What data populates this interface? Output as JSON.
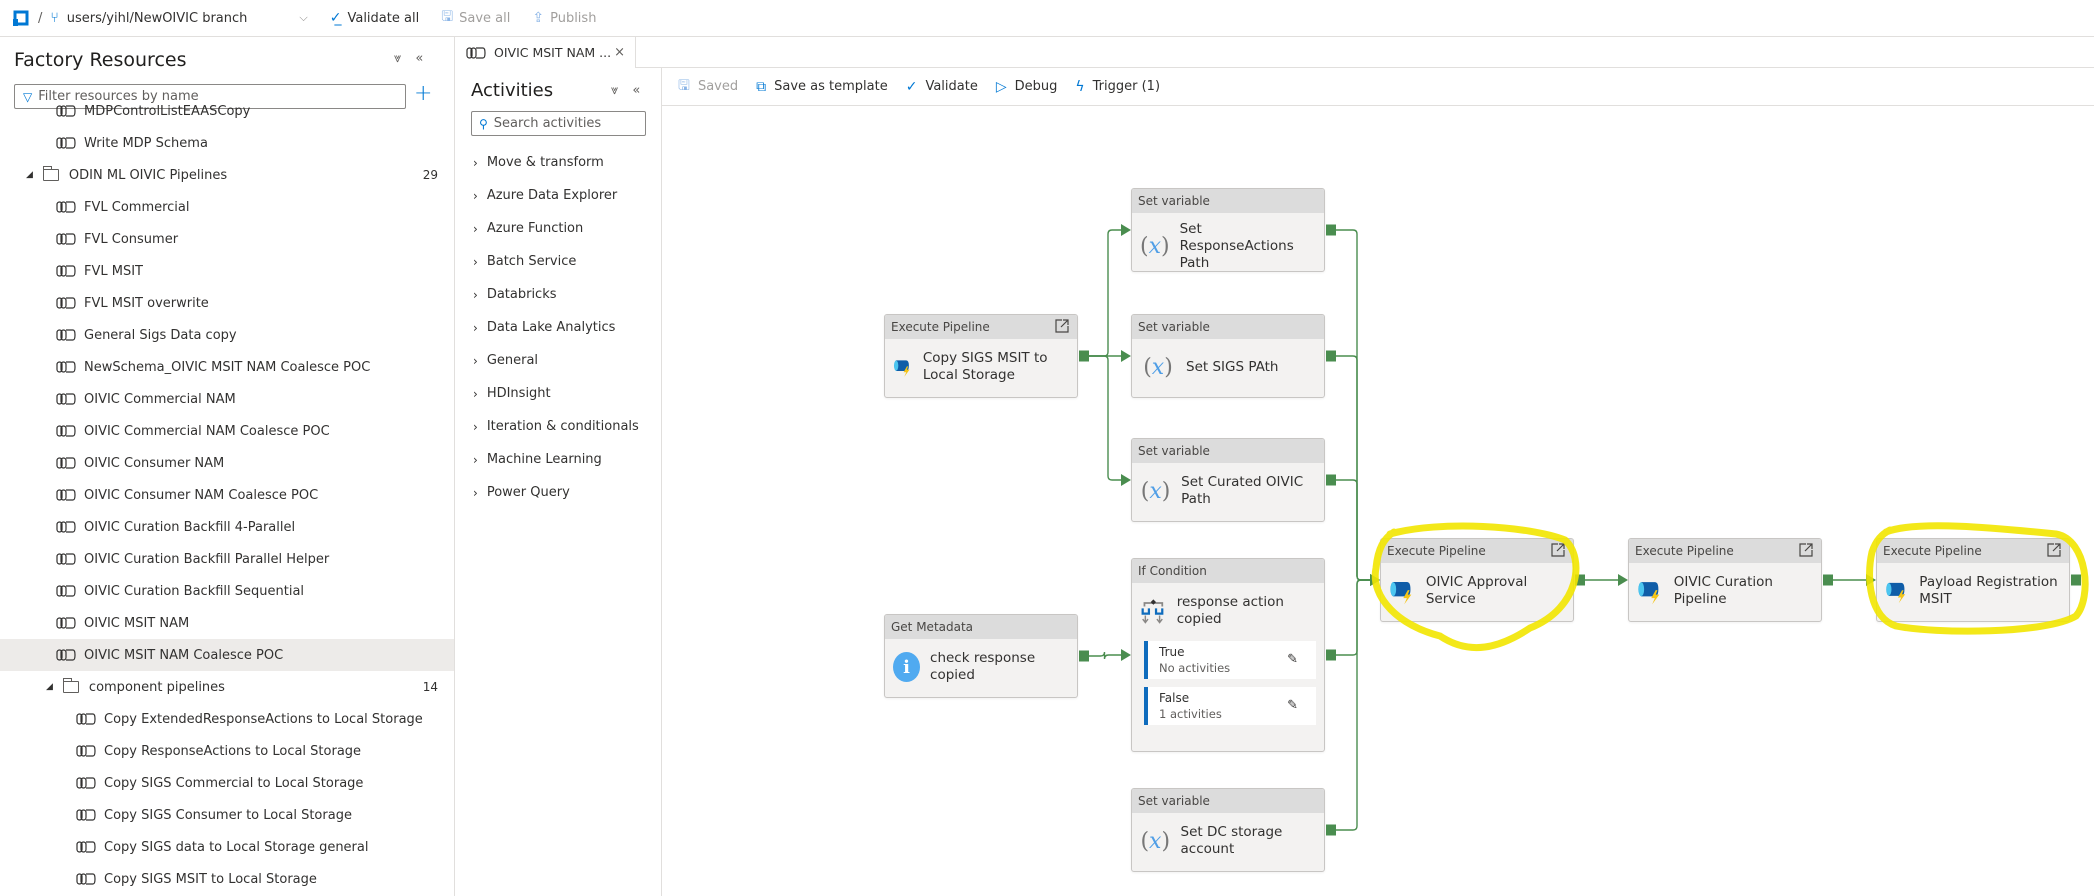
{
  "topbar": {
    "separator": "/",
    "branch": "users/yihl/NewOIVIC branch",
    "validate_all": "Validate all",
    "save_all": "Save all",
    "publish": "Publish"
  },
  "factory": {
    "title": "Factory Resources",
    "filter_placeholder": "Filter resources by name",
    "items": [
      {
        "type": "pipeline",
        "label": "MDPControlListEAASCopy",
        "level": 1,
        "partial": true
      },
      {
        "type": "pipeline",
        "label": "Write MDP Schema",
        "level": 1
      },
      {
        "type": "folder",
        "label": "ODIN ML OIVIC Pipelines",
        "count": "29",
        "level": 0
      },
      {
        "type": "pipeline",
        "label": "FVL Commercial",
        "level": 1
      },
      {
        "type": "pipeline",
        "label": "FVL Consumer",
        "level": 1
      },
      {
        "type": "pipeline",
        "label": "FVL MSIT",
        "level": 1
      },
      {
        "type": "pipeline",
        "label": "FVL MSIT overwrite",
        "level": 1
      },
      {
        "type": "pipeline",
        "label": "General Sigs Data copy",
        "level": 1
      },
      {
        "type": "pipeline",
        "label": "NewSchema_OIVIC MSIT NAM Coalesce POC",
        "level": 1
      },
      {
        "type": "pipeline",
        "label": "OIVIC Commercial NAM",
        "level": 1
      },
      {
        "type": "pipeline",
        "label": "OIVIC Commercial NAM Coalesce POC",
        "level": 1
      },
      {
        "type": "pipeline",
        "label": "OIVIC Consumer NAM",
        "level": 1
      },
      {
        "type": "pipeline",
        "label": "OIVIC Consumer NAM Coalesce POC",
        "level": 1
      },
      {
        "type": "pipeline",
        "label": "OIVIC Curation Backfill 4-Parallel",
        "level": 1
      },
      {
        "type": "pipeline",
        "label": "OIVIC Curation Backfill Parallel Helper",
        "level": 1
      },
      {
        "type": "pipeline",
        "label": "OIVIC Curation Backfill Sequential",
        "level": 1
      },
      {
        "type": "pipeline",
        "label": "OIVIC MSIT NAM",
        "level": 1
      },
      {
        "type": "pipeline",
        "label": "OIVIC MSIT NAM Coalesce POC",
        "level": 1,
        "selected": true
      },
      {
        "type": "folder",
        "label": "component pipelines",
        "count": "14",
        "level": 1
      },
      {
        "type": "pipeline",
        "label": "Copy ExtendedResponseActions to Local Storage",
        "level": 2
      },
      {
        "type": "pipeline",
        "label": "Copy ResponseActions to Local Storage",
        "level": 2
      },
      {
        "type": "pipeline",
        "label": "Copy SIGS Commercial to Local Storage",
        "level": 2
      },
      {
        "type": "pipeline",
        "label": "Copy SIGS Consumer to Local Storage",
        "level": 2
      },
      {
        "type": "pipeline",
        "label": "Copy SIGS data to Local Storage general",
        "level": 2
      },
      {
        "type": "pipeline",
        "label": "Copy SIGS MSIT to Local Storage",
        "level": 2
      }
    ]
  },
  "tab": {
    "label": "OIVIC MSIT NAM ...",
    "close": "×"
  },
  "activities": {
    "title": "Activities",
    "search_placeholder": "Search activities",
    "categories": [
      "Move & transform",
      "Azure Data Explorer",
      "Azure Function",
      "Batch Service",
      "Databricks",
      "Data Lake Analytics",
      "General",
      "HDInsight",
      "Iteration & conditionals",
      "Machine Learning",
      "Power Query"
    ]
  },
  "toolbar": {
    "saved": "Saved",
    "save_as_template": "Save as template",
    "validate": "Validate",
    "debug": "Debug",
    "trigger": "Trigger (1)"
  },
  "pipeline": {
    "nodes": [
      {
        "id": "copy_sigs",
        "type": "Execute Pipeline",
        "name": "Copy SIGS MSIT to Local Storage",
        "icon": "execute-pipeline"
      },
      {
        "id": "set_ra",
        "type": "Set variable",
        "name": "Set ResponseActions Path",
        "icon": "variable"
      },
      {
        "id": "set_sigs",
        "type": "Set variable",
        "name": "Set SIGS PAth",
        "icon": "variable"
      },
      {
        "id": "set_curated",
        "type": "Set variable",
        "name": "Set Curated OIVIC Path",
        "icon": "variable"
      },
      {
        "id": "get_meta",
        "type": "Get Metadata",
        "name": "check response copied",
        "icon": "info"
      },
      {
        "id": "if_cond",
        "type": "If Condition",
        "name": "response action copied",
        "icon": "if",
        "branches": [
          {
            "label": "True",
            "sub": "No activities"
          },
          {
            "label": "False",
            "sub": "1 activities"
          }
        ]
      },
      {
        "id": "set_dc",
        "type": "Set variable",
        "name": "Set DC storage account",
        "icon": "variable"
      },
      {
        "id": "approval",
        "type": "Execute Pipeline",
        "name": "OIVIC Approval Service",
        "icon": "execute-pipeline",
        "highlighted": true
      },
      {
        "id": "curation",
        "type": "Execute Pipeline",
        "name": "OIVIC Curation Pipeline",
        "icon": "execute-pipeline"
      },
      {
        "id": "payload",
        "type": "Execute Pipeline",
        "name": "Payload Registration MSIT",
        "icon": "execute-pipeline",
        "highlighted": true
      }
    ],
    "edges": [
      [
        "copy_sigs",
        "set_ra"
      ],
      [
        "copy_sigs",
        "set_sigs"
      ],
      [
        "copy_sigs",
        "set_curated"
      ],
      [
        "get_meta",
        "if_cond"
      ],
      [
        "set_ra",
        "approval"
      ],
      [
        "set_sigs",
        "approval"
      ],
      [
        "set_curated",
        "approval"
      ],
      [
        "if_cond",
        "approval"
      ],
      [
        "set_dc",
        "approval"
      ],
      [
        "approval",
        "curation"
      ],
      [
        "curation",
        "payload"
      ]
    ]
  },
  "colors": {
    "accent": "#0078d4",
    "success_edge": "#4a8d4f",
    "highlight": "#f2e600"
  }
}
